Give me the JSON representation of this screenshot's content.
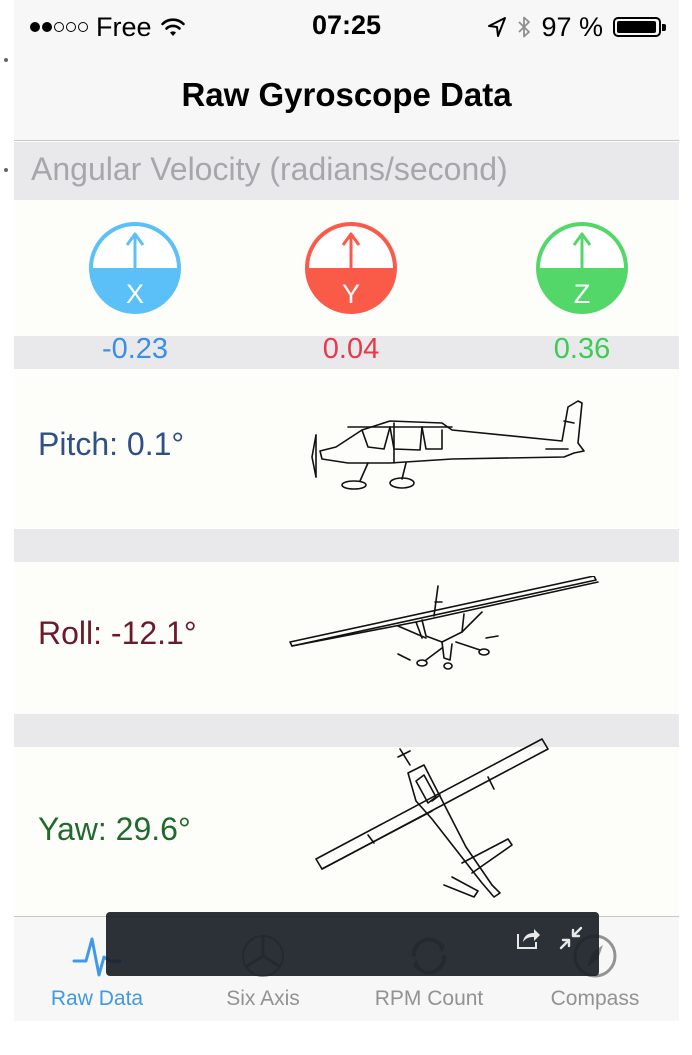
{
  "status_bar": {
    "carrier": "Free",
    "time": "07:25",
    "battery_percent": "97 %",
    "battery_level": 0.97,
    "icons": [
      "signal-dots-icon",
      "wifi-icon",
      "location-arrow-icon",
      "bluetooth-icon",
      "battery-icon"
    ]
  },
  "nav": {
    "title": "Raw Gyroscope Data"
  },
  "section": {
    "title": "Angular Velocity (radians/second)"
  },
  "gauges": [
    {
      "axis": "X",
      "value": "-0.23",
      "color": "#5ac0f7",
      "value_color": "#3a8ee6"
    },
    {
      "axis": "Y",
      "value": "0.04",
      "color": "#fa5a48",
      "value_color": "#e6394c"
    },
    {
      "axis": "Z",
      "value": "0.36",
      "color": "#53d769",
      "value_color": "#3ccc54"
    }
  ],
  "rows": {
    "pitch": {
      "label": "Pitch: 0.1°",
      "color": "#2f4f86"
    },
    "roll": {
      "label": "Roll: -12.1°",
      "color": "#6b1a2a"
    },
    "yaw": {
      "label": "Yaw:  29.6°",
      "color": "#1f6a2c"
    }
  },
  "tabs": [
    {
      "label": "Raw Data",
      "icon": "waveform-icon",
      "active": true
    },
    {
      "label": "Six Axis",
      "icon": "propeller-icon",
      "active": false
    },
    {
      "label": "RPM Count",
      "icon": "refresh-icon",
      "active": false
    },
    {
      "label": "Compass",
      "icon": "compass-icon",
      "active": false
    }
  ],
  "overlay": {
    "icons": [
      "share-icon",
      "collapse-icon"
    ]
  },
  "colors": {
    "accent": "#3f99e6",
    "tab_inactive": "#929292",
    "section_background": "#e9e9ec"
  }
}
